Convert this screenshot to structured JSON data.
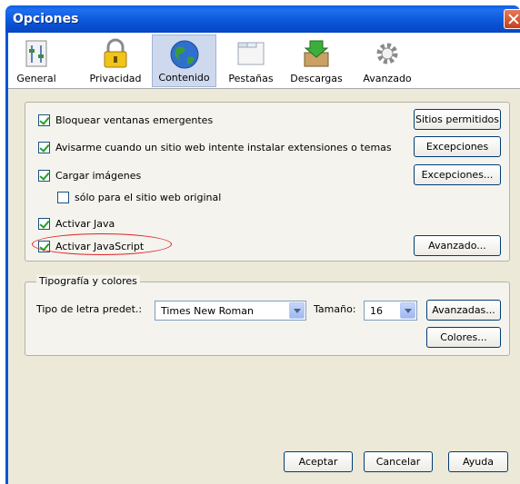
{
  "window": {
    "title": "Opciones"
  },
  "toolbar": {
    "items": [
      {
        "label": "General",
        "icon": "general-icon"
      },
      {
        "label": "Privacidad",
        "icon": "lock-icon"
      },
      {
        "label": "Contenido",
        "icon": "globe-icon",
        "active": true
      },
      {
        "label": "Pestañas",
        "icon": "tabs-icon"
      },
      {
        "label": "Descargas",
        "icon": "download-box-icon"
      },
      {
        "label": "Avanzado",
        "icon": "gear-icon"
      }
    ]
  },
  "content": {
    "block_popups": {
      "label": "Bloquear ventanas emergentes",
      "checked": true,
      "button": "Sitios permitidos"
    },
    "warn_addons": {
      "label": "Avisarme cuando un sitio web intente instalar extensiones o temas",
      "checked": true,
      "button": "Excepciones"
    },
    "load_images": {
      "label": "Cargar imágenes",
      "checked": true,
      "button": "Excepciones..."
    },
    "original_site_only": {
      "label": "sólo para el sitio web original",
      "checked": false
    },
    "enable_java": {
      "label": "Activar Java",
      "checked": true
    },
    "enable_javascript": {
      "label": "Activar JavaScript",
      "checked": true,
      "button": "Avanzado..."
    }
  },
  "fonts": {
    "legend": "Tipografía y colores",
    "default_font_label": "Tipo de letra predet.:",
    "default_font_value": "Times New Roman",
    "size_label": "Tamaño:",
    "size_value": "16",
    "advanced_button": "Avanzadas...",
    "colors_button": "Colores..."
  },
  "footer": {
    "accept": "Aceptar",
    "cancel": "Cancelar",
    "help": "Ayuda"
  },
  "colors": {
    "titlebar": "#0a55d8",
    "dialog": "#ece9d8",
    "highlight": "#d22222"
  }
}
